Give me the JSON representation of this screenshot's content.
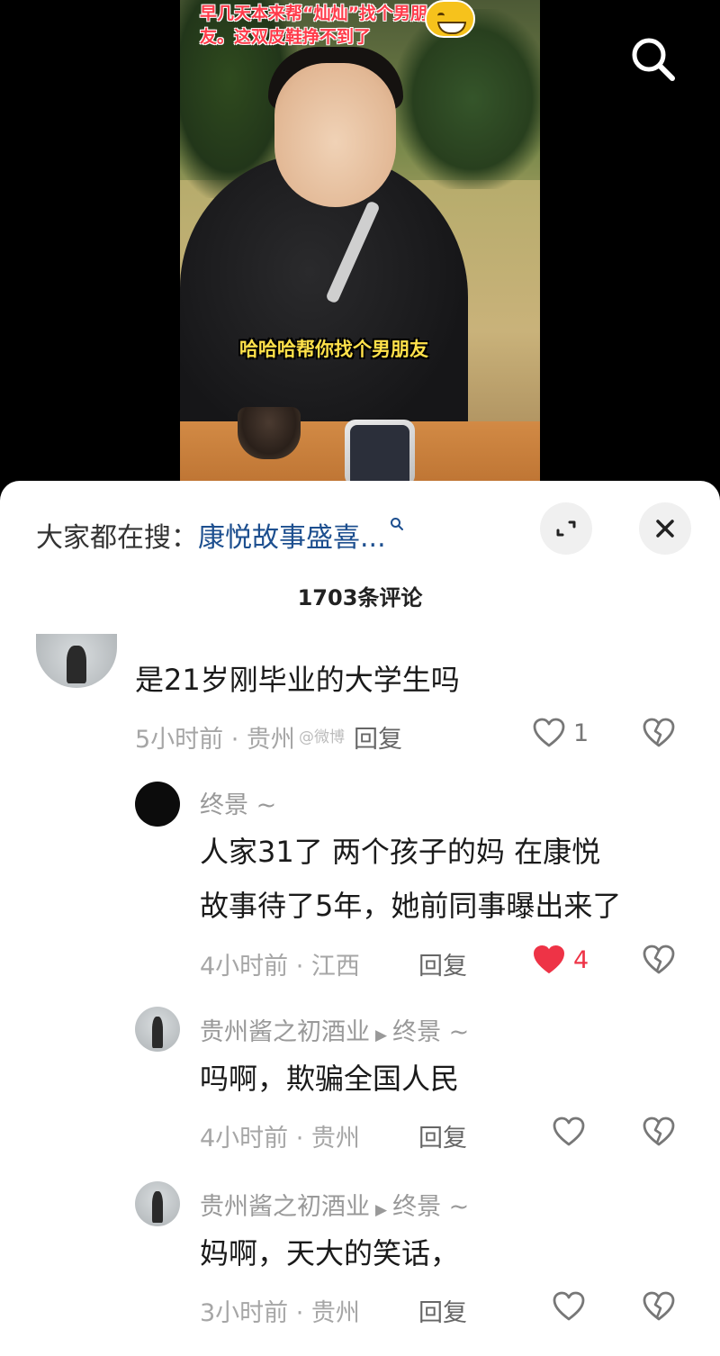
{
  "video": {
    "caption_top": "早几天本来帮“灿灿”找个男朋友。这双皮鞋挣不到了",
    "caption_mid": "哈哈哈帮你找个男朋友",
    "search_icon": "search-icon",
    "emoji_icon": "grinning-face-emoji"
  },
  "panel": {
    "trending_prefix": "大家都在搜：",
    "trending_keyword": "康悦故事盛喜...",
    "comment_count": "1703条评论",
    "expand_icon": "expand-icon",
    "close_icon": "close-icon"
  },
  "comments": [
    {
      "text": "是21岁刚毕业的大学生吗",
      "time_location": "5小时前 · 贵州",
      "reply_label": "回复",
      "likes": "1",
      "liked": false,
      "watermark": "@微博"
    },
    {
      "user": "终景",
      "user_suffix": "~",
      "text_lines": [
        "人家31了 两个孩子的妈 在康悦",
        "故事待了5年，她前同事曝出来了"
      ],
      "time_location": "4小时前 · 江西",
      "reply_label": "回复",
      "likes": "4",
      "liked": true
    },
    {
      "user": "贵州酱之初酒业",
      "reply_to": "终景 ~",
      "text": "吗啊，欺骗全国人民",
      "time_location": "4小时前 · 贵州",
      "reply_label": "回复",
      "liked": false
    },
    {
      "user": "贵州酱之初酒业",
      "reply_to": "终景 ~",
      "text": "妈啊，天大的笑话，",
      "time_location": "3小时前 · 贵州",
      "reply_label": "回复",
      "liked": false
    }
  ],
  "colors": {
    "like_active": "#ee3346",
    "keyword_blue": "#1d4f8f",
    "caption_red": "#ff3b4a",
    "caption_yellow": "#ffe14a"
  }
}
